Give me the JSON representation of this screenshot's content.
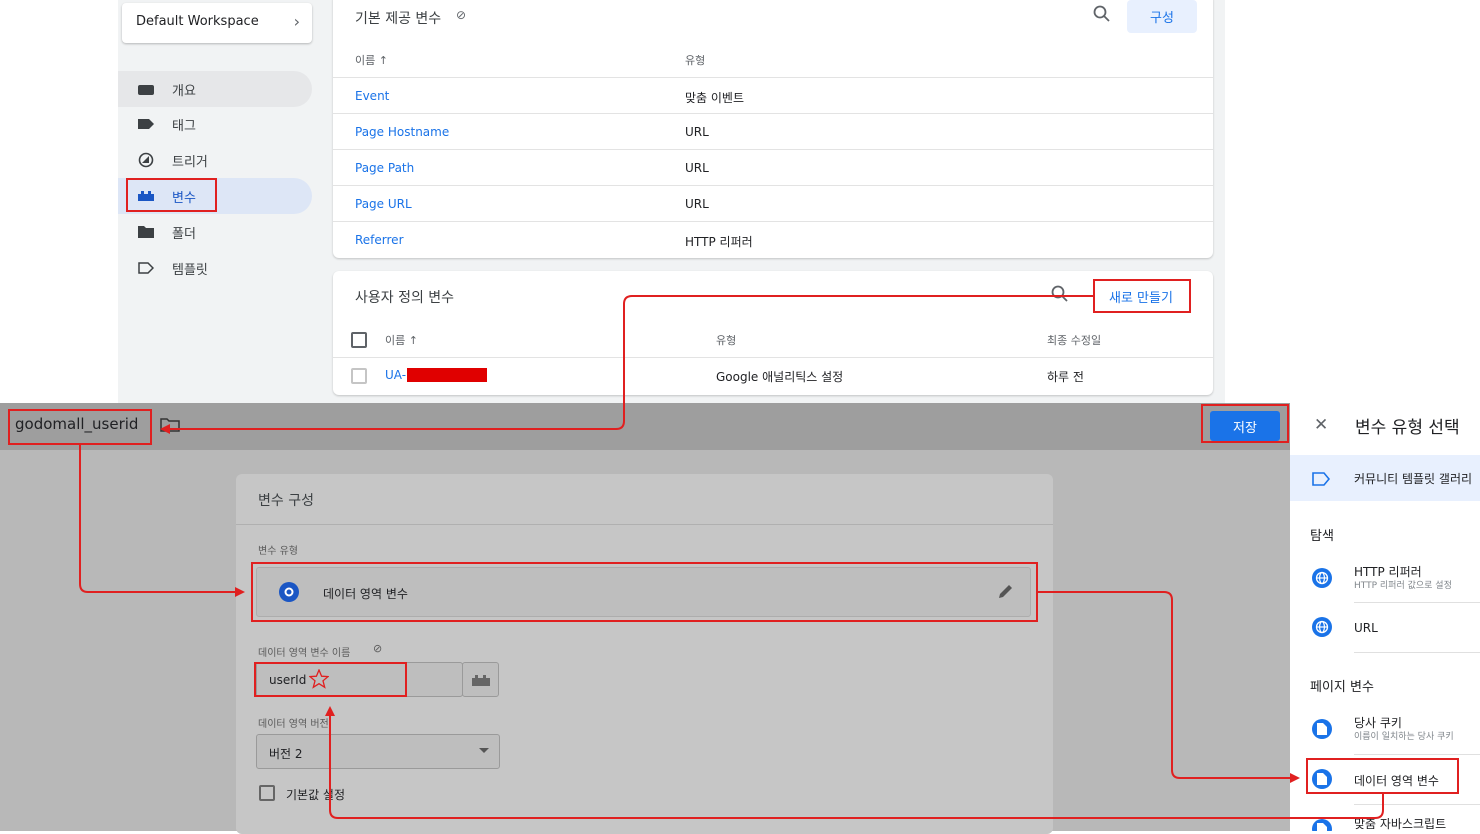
{
  "sidebar": {
    "workspace": "Default Workspace",
    "items": [
      {
        "label": "개요"
      },
      {
        "label": "태그"
      },
      {
        "label": "트리거"
      },
      {
        "label": "변수"
      },
      {
        "label": "폴더"
      },
      {
        "label": "템플릿"
      }
    ]
  },
  "builtin": {
    "title": "기본 제공 변수",
    "configure_label": "구성",
    "col_name": "이름 ↑",
    "col_type": "유형",
    "rows": [
      {
        "name": "Event",
        "type": "맞춤 이벤트"
      },
      {
        "name": "Page Hostname",
        "type": "URL"
      },
      {
        "name": "Page Path",
        "type": "URL"
      },
      {
        "name": "Page URL",
        "type": "URL"
      },
      {
        "name": "Referrer",
        "type": "HTTP 리퍼러"
      }
    ]
  },
  "user_defined": {
    "title": "사용자 정의 변수",
    "new_label": "새로 만들기",
    "col_name": "이름 ↑",
    "col_type": "유형",
    "col_modified": "최종 수정일",
    "rows": [
      {
        "name": "UA-",
        "type": "Google 애널리틱스 설정",
        "modified": "하루 전"
      }
    ]
  },
  "editor": {
    "variable_name": "godomall_userid",
    "save_label": "저장",
    "card_title": "변수 구성",
    "type_label": "변수 유형",
    "type_value": "데이터 영역 변수",
    "dl_name_label": "데이터 영역 변수 이름",
    "dl_name_value": "userId",
    "version_label": "데이터 영역 버전",
    "version_value": "버전 2",
    "default_label": "기본값 설정"
  },
  "drawer": {
    "title": "변수 유형 선택",
    "community": "커뮤니티 템플릿 갤러리",
    "section_nav": "탐색",
    "section_page": "페이지 변수",
    "items": [
      {
        "title": "HTTP 리퍼러",
        "desc": "HTTP 리퍼러 값으로 설정"
      },
      {
        "title": "URL",
        "desc": ""
      },
      {
        "title": "당사 쿠키",
        "desc": "이름이 일치하는 당사 쿠키"
      },
      {
        "title": "데이터 영역 변수",
        "desc": ""
      },
      {
        "title": "맞춤 자바스크립트",
        "desc": ""
      }
    ]
  },
  "colors": {
    "accent": "#1a73e8",
    "annotation": "#e02020",
    "selected_nav": "#dde6f6"
  }
}
